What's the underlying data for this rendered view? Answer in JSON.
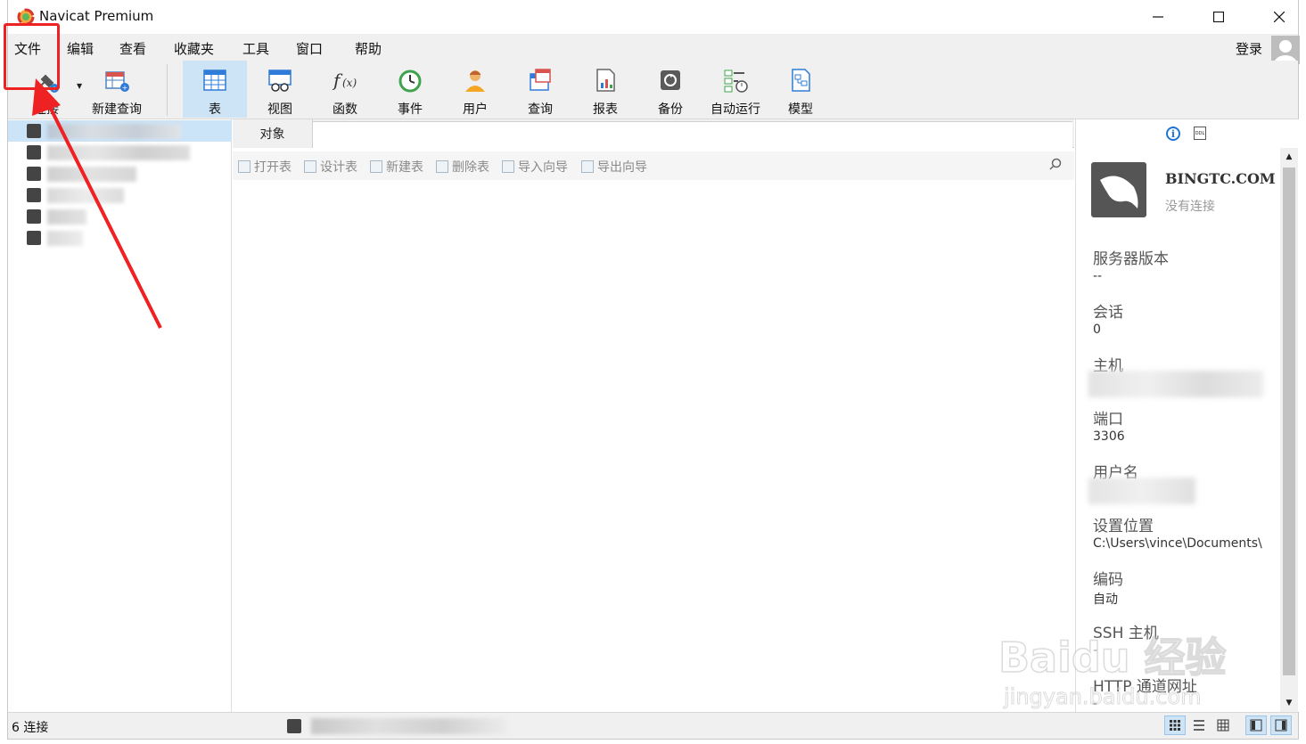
{
  "window": {
    "title": "Navicat Premium"
  },
  "menu": [
    "文件",
    "编辑",
    "查看",
    "收藏夹",
    "工具",
    "窗口",
    "帮助"
  ],
  "account": {
    "login_label": "登录"
  },
  "toolbar": {
    "connect": "连接",
    "new_query": "新建查询",
    "tools": [
      {
        "label": "表",
        "icon": "table-icon",
        "active": true
      },
      {
        "label": "视图",
        "icon": "view-icon"
      },
      {
        "label": "函数",
        "icon": "function-icon"
      },
      {
        "label": "事件",
        "icon": "clock-icon"
      },
      {
        "label": "用户",
        "icon": "user-icon"
      },
      {
        "label": "查询",
        "icon": "query-icon"
      },
      {
        "label": "报表",
        "icon": "report-icon"
      },
      {
        "label": "备份",
        "icon": "backup-icon"
      },
      {
        "label": "自动运行",
        "icon": "schedule-icon"
      },
      {
        "label": "模型",
        "icon": "model-icon"
      }
    ]
  },
  "tabs": {
    "object": "对象"
  },
  "object_actions": [
    "打开表",
    "设计表",
    "新建表",
    "删除表",
    "导入向导",
    "导出向导"
  ],
  "connection": {
    "name": "BINGTC.COM",
    "status": "没有连接",
    "props": {
      "server_version_label": "服务器版本",
      "server_version": "--",
      "sessions_label": "会话",
      "sessions": "0",
      "host_label": "主机",
      "port_label": "端口",
      "port": "3306",
      "username_label": "用户名",
      "settings_location_label": "设置位置",
      "settings_location": "C:\\Users\\vince\\Documents\\",
      "encoding_label": "编码",
      "encoding": "自动",
      "ssh_host_label": "SSH 主机",
      "ssh_host": "-",
      "http_url_label": "HTTP 通道网址",
      "http_url": "-"
    }
  },
  "status": {
    "connection_count": "6 连接"
  },
  "watermark": {
    "brand": "Baidu 经验",
    "url": "jingyan.baidu.com"
  },
  "colors": {
    "accent": "#1e73d6",
    "active_tool": "#cde3f6",
    "selected_row": "#cce4f7",
    "annotation": "#ee2222"
  }
}
